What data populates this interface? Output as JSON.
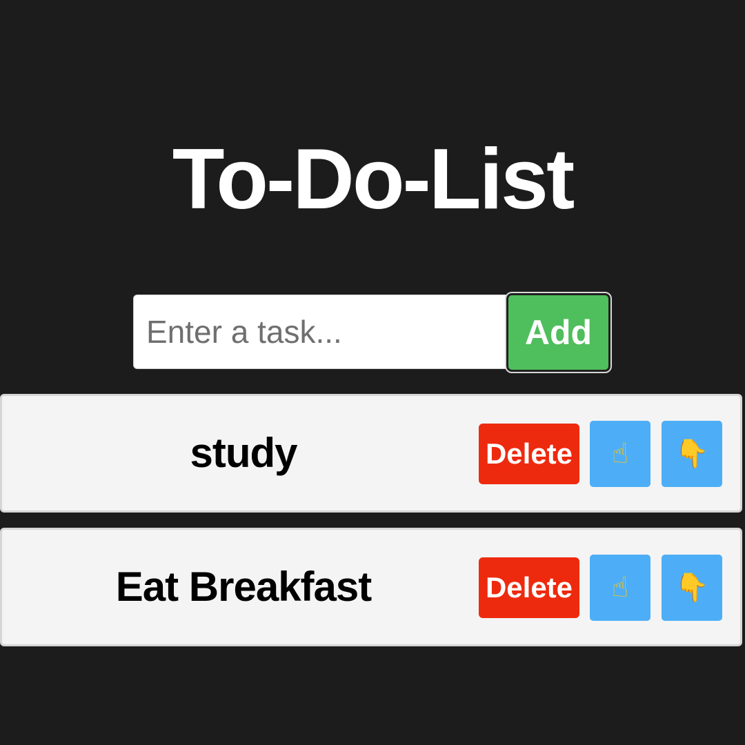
{
  "app": {
    "title": "To-Do-List"
  },
  "input": {
    "placeholder": "Enter a task...",
    "value": "",
    "add_label": "Add"
  },
  "colors": {
    "background": "#1c1c1c",
    "add_button": "#4fbe5c",
    "delete_button": "#ee2a0e",
    "move_button": "#4daef7",
    "item_background": "#f4f4f4"
  },
  "tasks": [
    {
      "text": "study",
      "delete_label": "Delete",
      "move_up_icon": "pointing-up-icon",
      "move_up_glyph": "☝",
      "move_down_icon": "pointing-down-icon",
      "move_down_glyph": "👇"
    },
    {
      "text": "Eat Breakfast",
      "delete_label": "Delete",
      "move_up_icon": "pointing-up-icon",
      "move_up_glyph": "☝",
      "move_down_icon": "pointing-down-icon",
      "move_down_glyph": "👇"
    }
  ]
}
